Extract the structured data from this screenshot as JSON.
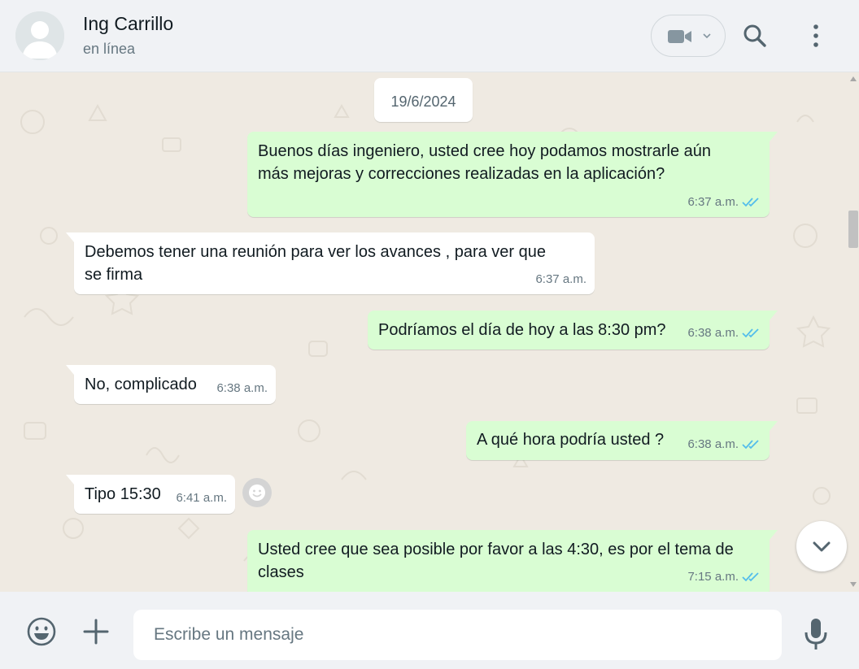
{
  "header": {
    "contact_name": "Ing Carrillo",
    "contact_status": "en línea",
    "icons": [
      "avatar",
      "video-call-icon",
      "chevron-down-icon",
      "search-icon",
      "more-options-icon"
    ]
  },
  "chat": {
    "date_chip": "19/6/2024",
    "messages": [
      {
        "direction": "out",
        "lines": [
          "Buenos días ingeniero, usted cree hoy podamos mostrarle aún",
          "más mejoras y correcciones realizadas en la aplicación?"
        ],
        "time": "6:37 a.m.",
        "status": "read"
      },
      {
        "direction": "in",
        "lines": [
          "Debemos tener una reunión para ver los avances , para ver que",
          "se firma"
        ],
        "time": "6:37 a.m."
      },
      {
        "direction": "out",
        "lines": [
          "Podríamos el día de hoy a las 8:30 pm?"
        ],
        "time": "6:38 a.m.",
        "status": "read"
      },
      {
        "direction": "in",
        "lines": [
          "No, complicado"
        ],
        "time": "6:38 a.m."
      },
      {
        "direction": "out",
        "lines": [
          "A qué hora podría usted ?"
        ],
        "time": "6:38 a.m.",
        "status": "read"
      },
      {
        "direction": "in",
        "lines": [
          "Tipo 15:30"
        ],
        "time": "6:41 a.m."
      },
      {
        "direction": "out",
        "lines": [
          "Usted cree que sea posible por favor a las 4:30, es por el tema de",
          "clases"
        ],
        "time": "7:15 a.m.",
        "status": "read"
      }
    ]
  },
  "footer": {
    "placeholder": "Escribe un mensaje",
    "icons": [
      "emoji-icon",
      "attach-plus-icon",
      "microphone-icon"
    ]
  },
  "colors": {
    "outgoing_bubble": "#d9fdd3",
    "incoming_bubble": "#ffffff",
    "chat_background": "#efeae2",
    "panel_background": "#f0f2f5",
    "read_ticks": "#53bdeb",
    "icon_gray": "#54656f"
  }
}
